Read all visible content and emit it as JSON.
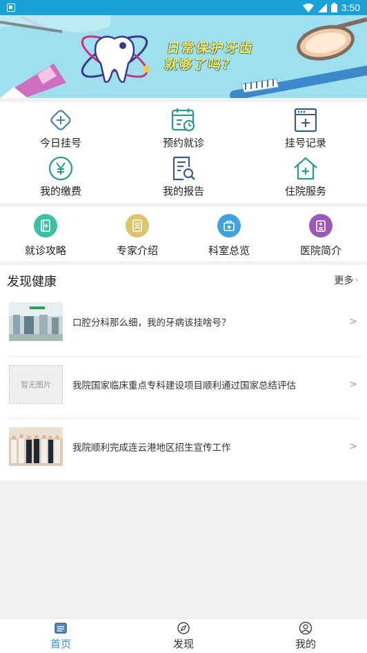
{
  "status_bar": {
    "time": "3:50"
  },
  "banner": {
    "title_line1": "日常保护牙齿",
    "title_line2": "就够了吗？"
  },
  "quick_menu": [
    {
      "label": "今日挂号",
      "icon": "add-diamond-icon"
    },
    {
      "label": "预约就诊",
      "icon": "calendar-clock-icon"
    },
    {
      "label": "挂号记录",
      "icon": "register-record-icon"
    },
    {
      "label": "我的缴费",
      "icon": "yen-coin-icon"
    },
    {
      "label": "我的报告",
      "icon": "report-search-icon"
    },
    {
      "label": "住院服务",
      "icon": "hospital-house-icon"
    }
  ],
  "info_menu": [
    {
      "label": "就诊攻略",
      "icon": "guide-book-icon",
      "color": "#3cbfa3"
    },
    {
      "label": "专家介绍",
      "icon": "expert-id-icon",
      "color": "#dcc46c"
    },
    {
      "label": "科室总览",
      "icon": "medical-kit-icon",
      "color": "#3ea3dc"
    },
    {
      "label": "医院简介",
      "icon": "hospital-info-icon",
      "color": "#9b58b5"
    }
  ],
  "news": {
    "title": "发现健康",
    "more_label": "更多",
    "items": [
      {
        "title": "口腔分科那么细，我的牙病该挂啥号？",
        "thumb": "clinic-photo"
      },
      {
        "title": "我院国家临床重点专科建设项目顺利通过国家总结评估",
        "thumb": "placeholder",
        "placeholder_text": "暂无图片"
      },
      {
        "title": "我院顺利完成连云港地区招生宣传工作",
        "thumb": "group-photo"
      }
    ]
  },
  "tab_bar": {
    "tabs": [
      {
        "label": "首页",
        "icon": "home-icon",
        "active": true
      },
      {
        "label": "发现",
        "icon": "compass-icon",
        "active": false
      },
      {
        "label": "我的",
        "icon": "user-icon",
        "active": false
      }
    ],
    "active_color": "#2f8fd1"
  }
}
